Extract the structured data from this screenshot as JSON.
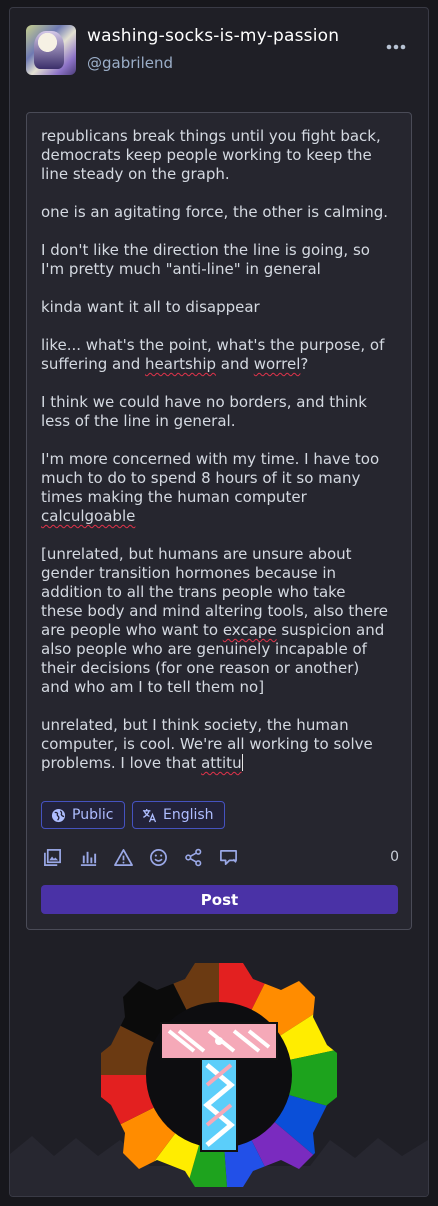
{
  "account": {
    "display_name": "washing-socks-is-my-passion",
    "handle": "@gabrilend",
    "menu_icon": "ellipsis-icon"
  },
  "composer": {
    "text_lines": [
      "republicans break things until you fight back,",
      "democrats keep people working to keep the",
      "line steady on the graph.",
      "",
      "one is an agitating force, the other is calming.",
      "",
      "I don't like the direction the line is going, so",
      "I'm pretty much \"anti-line\" in general",
      "",
      "kinda want it all to disappear",
      "",
      "like... what's the point, what's the purpose, of",
      "suffering and heartship and worrel?",
      "",
      "I think we could have no borders, and think",
      "less of the line in general.",
      "",
      "I'm more concerned with my time. I have too",
      "much to do to spend 8 hours of it so many",
      "times making the human computer",
      "calculgoable",
      "",
      "[unrelated, but humans are unsure about",
      "gender transition hormones because in",
      "addition to all the trans people who take",
      "these body and mind altering tools, also there",
      "are people who want to excape suspicion and",
      "also people who are genuinely incapable of",
      "their decisions (for one reason or another)",
      "and who am I to tell them no]",
      "",
      "unrelated, but I think society, the human",
      "computer, is cool. We're all working to solve",
      "problems. I love that attitu"
    ],
    "misspelled_words": [
      "heartship",
      "worrel",
      "calculgoable",
      "excape",
      "attitu"
    ],
    "visibility_label": "Public",
    "language_label": "English",
    "character_counter": "0",
    "post_label": "Post",
    "toolbar_icons": [
      "media-icon",
      "poll-icon",
      "content-warning-icon",
      "emoji-icon",
      "share-icon",
      "quote-icon"
    ]
  },
  "colors": {
    "background": "#17171c",
    "panel": "#1f1f26",
    "composer": "#26262f",
    "accent": "#4a32a6",
    "pill_border": "#4552c0",
    "spellcheck": "#e0334a"
  },
  "mascot": {
    "icon": "trans-rainbow-gear-logo-icon"
  }
}
